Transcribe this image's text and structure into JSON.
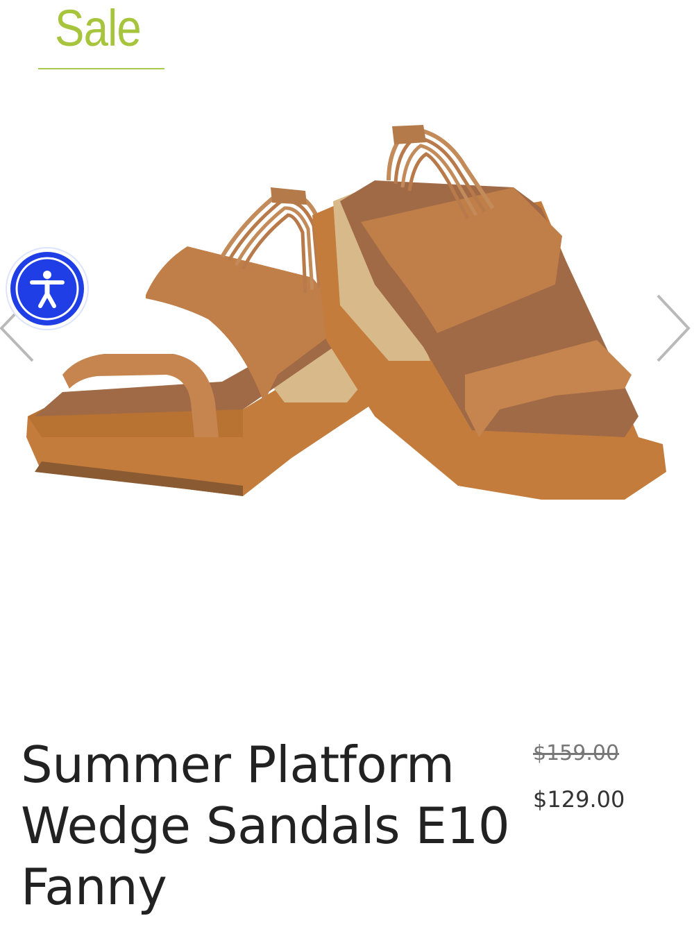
{
  "header": {
    "sale_label": "Sale"
  },
  "product": {
    "title": "Summer Platform Wedge Sandals E10 Fanny",
    "price_original": "$159.00",
    "price_sale": "$129.00"
  },
  "gallery": {
    "image_alt": "Summer Platform Wedge Sandals E10 Fanny",
    "prev_icon": "chevron-left-icon",
    "next_icon": "chevron-right-icon"
  },
  "accessibility_widget": {
    "icon": "accessibility-icon",
    "label": "Accessibility"
  },
  "colors": {
    "sale_accent": "#a6c43c",
    "a11y_blue": "#1f3ee6",
    "price_old": "#777777",
    "text": "#222222"
  }
}
